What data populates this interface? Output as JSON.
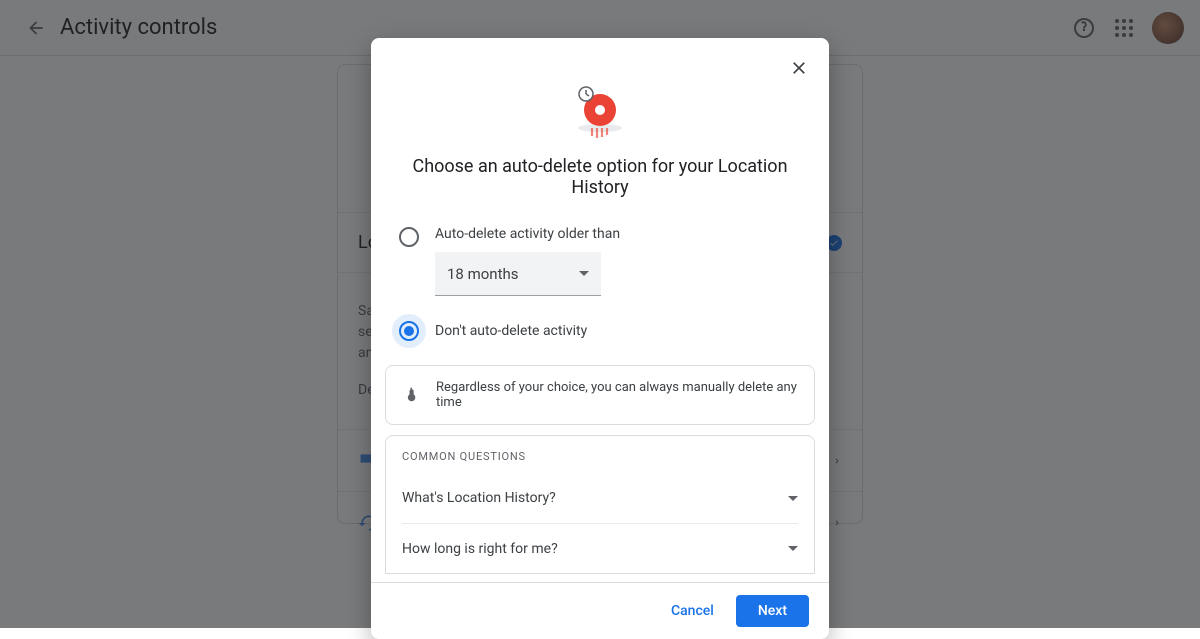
{
  "header": {
    "title": "Activity controls"
  },
  "bg_card": {
    "title": "Lo",
    "body_line1": "Sa",
    "body_line2": "ser",
    "body_line3": "and",
    "body_line4": "De"
  },
  "dialog": {
    "title": "Choose an auto-delete option for your Location History",
    "option1_label": "Auto-delete activity older than",
    "select_value": "18 months",
    "option2_label": "Don't auto-delete activity",
    "selected_option": 2,
    "info_text": "Regardless of your choice, you can always manually delete any time",
    "faq_title": "Common questions",
    "faq_items": [
      "What's Location History?",
      "How long is right for me?"
    ],
    "cancel_label": "Cancel",
    "next_label": "Next"
  }
}
